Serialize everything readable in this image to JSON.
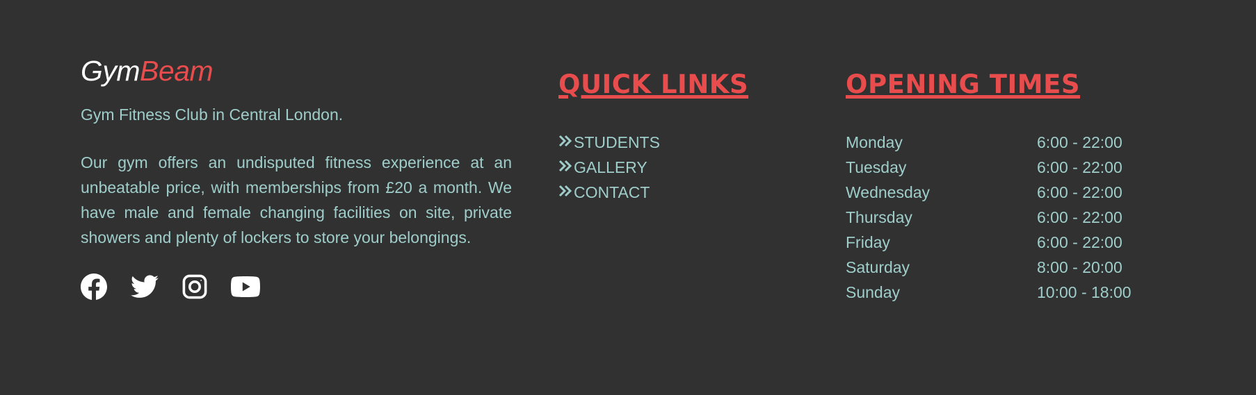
{
  "brand": {
    "name_part1": "Gym",
    "name_part2": "Beam"
  },
  "about": {
    "tagline": "Gym Fitness Club in Central London.",
    "description": "Our gym offers an undisputed fitness experience at an unbeatable price, with memberships from £20 a month. We have male and female changing facilities on site, private showers and plenty of lockers to store your belongings."
  },
  "social": [
    {
      "icon": "facebook-icon"
    },
    {
      "icon": "twitter-icon"
    },
    {
      "icon": "instagram-icon"
    },
    {
      "icon": "youtube-icon"
    }
  ],
  "quick_links": {
    "heading": "QUICK LINKS",
    "items": [
      {
        "label": "STUDENTS",
        "icon": "double-chevron-right-icon"
      },
      {
        "label": "GALLERY",
        "icon": "double-chevron-right-icon"
      },
      {
        "label": "CONTACT",
        "icon": "double-chevron-right-icon"
      }
    ]
  },
  "opening_times": {
    "heading": "OPENING TIMES",
    "rows": [
      {
        "day": "Monday",
        "time": "6:00 - 22:00"
      },
      {
        "day": "Tuesday",
        "time": "6:00 - 22:00"
      },
      {
        "day": "Wednesday",
        "time": "6:00 - 22:00"
      },
      {
        "day": "Thursday",
        "time": "6:00 - 22:00"
      },
      {
        "day": "Friday",
        "time": "6:00 - 22:00"
      },
      {
        "day": "Saturday",
        "time": "8:00 - 20:00"
      },
      {
        "day": "Sunday",
        "time": "10:00 - 18:00"
      }
    ]
  },
  "colors": {
    "background": "#313131",
    "accent": "#e84c4c",
    "text": "#9ecdca",
    "white": "#ffffff"
  }
}
